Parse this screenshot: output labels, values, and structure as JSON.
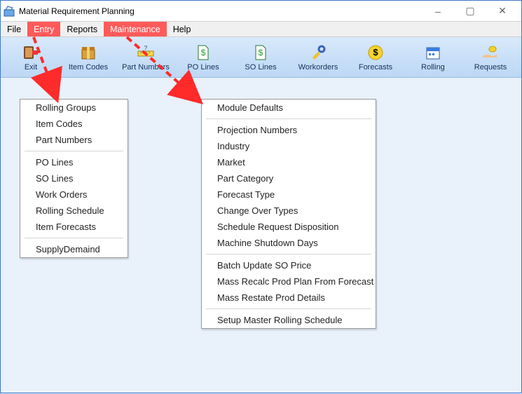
{
  "window": {
    "title": "Material Requirement Planning",
    "minimize": "–",
    "maximize": "▢",
    "close": "✕"
  },
  "menubar": {
    "file": "File",
    "entry": "Entry",
    "reports": "Reports",
    "maintenance": "Maintenance",
    "help": "Help"
  },
  "toolbar": [
    {
      "key": "exit",
      "label": "Exit"
    },
    {
      "key": "itemcodes",
      "label": "Item Codes"
    },
    {
      "key": "partnumbers",
      "label": "Part Numbers"
    },
    {
      "key": "polines",
      "label": "PO Lines"
    },
    {
      "key": "solines",
      "label": "SO Lines"
    },
    {
      "key": "workorders",
      "label": "Workorders"
    },
    {
      "key": "forecasts",
      "label": "Forecasts"
    },
    {
      "key": "rolling",
      "label": "Rolling"
    },
    {
      "key": "requests",
      "label": "Requests"
    }
  ],
  "entry_menu": {
    "group1": [
      "Rolling Groups",
      "Item Codes",
      "Part Numbers"
    ],
    "group2": [
      "PO Lines",
      "SO Lines",
      "Work Orders",
      "Rolling Schedule",
      "Item Forecasts"
    ],
    "group3": [
      "SupplyDemaind"
    ]
  },
  "maintenance_menu": {
    "group1": [
      "Module Defaults"
    ],
    "group2": [
      "Projection Numbers",
      "Industry",
      "Market",
      "Part Category",
      "Forecast Type",
      "Change Over Types",
      "Schedule Request Disposition",
      "Machine Shutdown Days"
    ],
    "group3": [
      "Batch Update SO Price",
      "Mass Recalc Prod Plan From Forecast",
      "Mass Restate Prod Details"
    ],
    "group4": [
      "Setup Master Rolling Schedule"
    ]
  }
}
